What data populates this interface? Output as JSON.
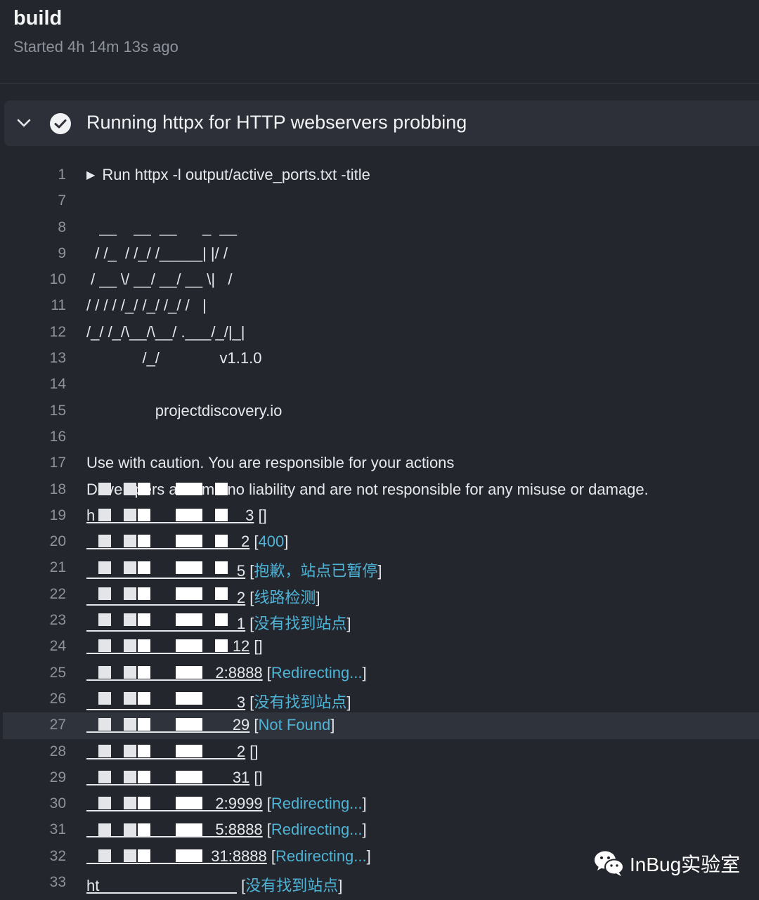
{
  "header": {
    "title": "build",
    "subtitle": "Started 4h 14m 13s ago"
  },
  "step": {
    "title": "Running httpx for HTTP webservers probbing",
    "status_icon": "check-circle-icon",
    "toggle_icon": "chevron-down-icon"
  },
  "log": {
    "lines": [
      {
        "n": "1",
        "text": "Run httpx -l output/active_ports.txt -title"
      },
      {
        "n": "7",
        "text": ""
      },
      {
        "n": "8",
        "text": "   __    __  __      _  __"
      },
      {
        "n": "9",
        "text": "  / /_  / /_/ /_____| |/ /"
      },
      {
        "n": "10",
        "text": " / __ \\/ __/ __/ __ \\|   /"
      },
      {
        "n": "11",
        "text": "/ / / / /_/ /_/ /_/ /   |"
      },
      {
        "n": "12",
        "text": "/_/ /_/\\__/\\__/ .___/_/|_|"
      },
      {
        "n": "13",
        "text": "             /_/              v1.1.0"
      },
      {
        "n": "14",
        "text": ""
      },
      {
        "n": "15",
        "text": "                projectdiscovery.io"
      },
      {
        "n": "16",
        "text": ""
      },
      {
        "n": "17",
        "text": "Use with caution. You are responsible for your actions"
      },
      {
        "n": "18",
        "text": "Developers assume no liability and are not responsible for any misuse or damage."
      },
      {
        "n": "19",
        "url": "h                                   3",
        "title": ""
      },
      {
        "n": "20",
        "url": "                                    2",
        "title": "400"
      },
      {
        "n": "21",
        "url": "                                   5",
        "title": "抱歉，站点已暂停"
      },
      {
        "n": "22",
        "url": "                                   2",
        "title": "线路检测"
      },
      {
        "n": "23",
        "url": "                                   1",
        "title": "没有找到站点"
      },
      {
        "n": "24",
        "url": "                                  12",
        "title": ""
      },
      {
        "n": "25",
        "url": "                              2:8888",
        "title": "Redirecting..."
      },
      {
        "n": "26",
        "url": "                                   3",
        "title": "没有找到站点"
      },
      {
        "n": "27",
        "url": "                                  29",
        "title": "Not Found"
      },
      {
        "n": "28",
        "url": "                                   2",
        "title": ""
      },
      {
        "n": "29",
        "url": "                                  31",
        "title": ""
      },
      {
        "n": "30",
        "url": "                              2:9999",
        "title": "Redirecting..."
      },
      {
        "n": "31",
        "url": "                              5:8888",
        "title": "Redirecting..."
      },
      {
        "n": "32",
        "url": "                             31:8888",
        "title": "Redirecting..."
      },
      {
        "n": "33",
        "url": "ht                                ",
        "title": "没有找到站点"
      }
    ],
    "highlight_line": "27"
  },
  "watermark": {
    "text": "InBug实验室",
    "icon": "wechat-icon"
  }
}
